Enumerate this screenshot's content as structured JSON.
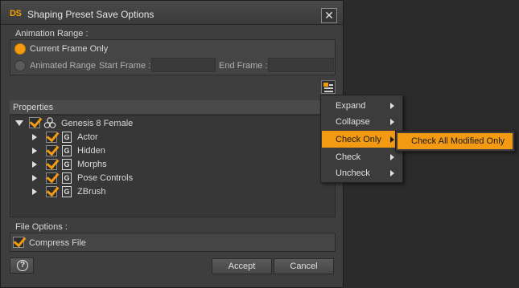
{
  "window": {
    "title": "Shaping Preset Save Options",
    "logo": "DS",
    "close_glyph": "✕"
  },
  "animation_range": {
    "label": "Animation Range :",
    "current_frame_only": "Current Frame Only",
    "animated_range": "Animated Range",
    "start_frame_label": "Start Frame :",
    "end_frame_label": "End Frame :",
    "start_frame_value": "",
    "end_frame_value": "",
    "selected": "current_frame_only"
  },
  "properties": {
    "header": "Properties",
    "root": {
      "label": "Genesis 8 Female",
      "checked": true,
      "expanded": true
    },
    "children": [
      {
        "label": "Actor",
        "icon_letter": "G",
        "checked": true
      },
      {
        "label": "Hidden",
        "icon_letter": "G",
        "checked": true
      },
      {
        "label": "Morphs",
        "icon_letter": "G",
        "checked": true
      },
      {
        "label": "Pose Controls",
        "icon_letter": "G",
        "checked": true
      },
      {
        "label": "ZBrush",
        "icon_letter": "G",
        "checked": true
      }
    ]
  },
  "file_options": {
    "label": "File Options :",
    "compress_file": "Compress File",
    "compress_checked": true
  },
  "buttons": {
    "accept": "Accept",
    "cancel": "Cancel",
    "help_glyph": "?"
  },
  "context_menu": {
    "items": [
      {
        "label": "Expand",
        "has_submenu": true
      },
      {
        "label": "Collapse",
        "has_submenu": true
      },
      {
        "label": "Check Only",
        "has_submenu": true,
        "active": true
      },
      {
        "label": "Check",
        "has_submenu": true
      },
      {
        "label": "Uncheck",
        "has_submenu": true
      }
    ],
    "submenu": {
      "item": "Check All Modified Only"
    }
  },
  "colors": {
    "accent": "#f39a12",
    "window_bg": "#3e3e3e",
    "panel_bg": "#454545"
  }
}
